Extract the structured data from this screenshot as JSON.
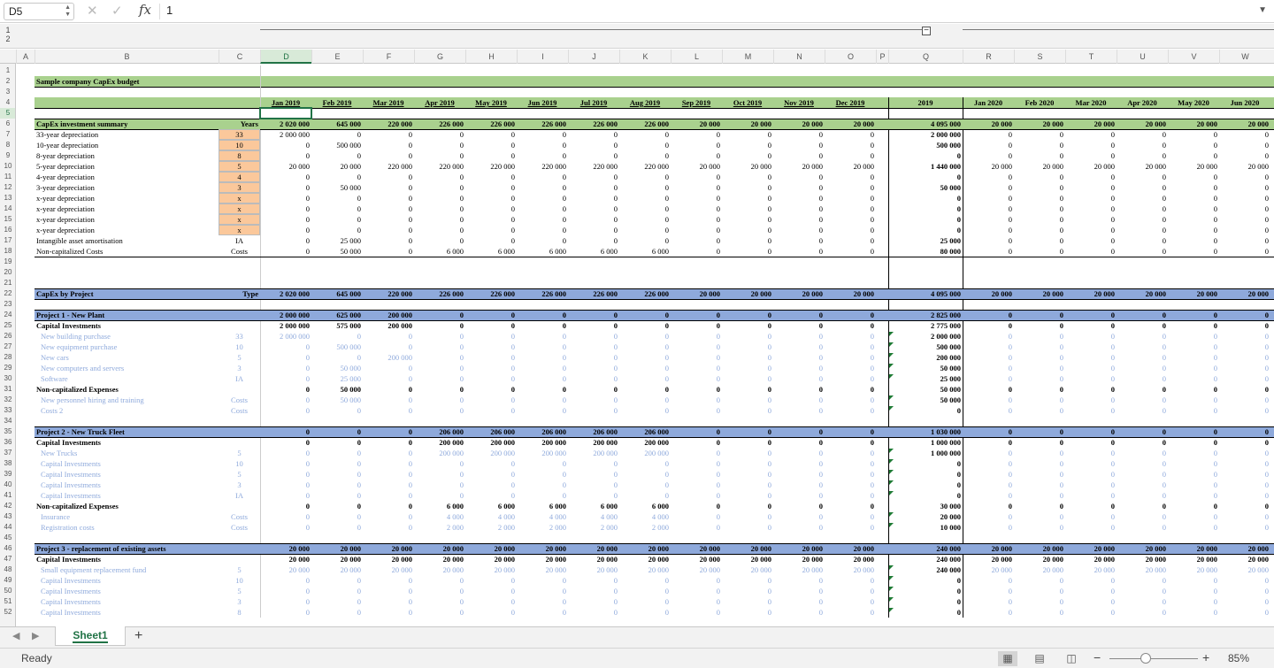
{
  "formula_bar": {
    "name_box": "D5",
    "value": "1",
    "fx": "fx",
    "cancel": "✕",
    "enter": "✓"
  },
  "outline": {
    "levels": [
      "1",
      "2"
    ],
    "collapse": "−"
  },
  "columns": [
    "A",
    "B",
    "C",
    "D",
    "E",
    "F",
    "G",
    "H",
    "I",
    "J",
    "K",
    "L",
    "M",
    "N",
    "O",
    "P",
    "Q",
    "R",
    "S",
    "T",
    "U",
    "V",
    "W"
  ],
  "selected_col": "D",
  "selected_row": 5,
  "row_count": 52,
  "title": "Sample company CapEx budget",
  "months": [
    "Jan 2019",
    "Feb 2019",
    "Mar 2019",
    "Apr 2019",
    "May 2019",
    "Jun 2019",
    "Jul 2019",
    "Aug 2019",
    "Sep 2019",
    "Oct 2019",
    "Nov 2019",
    "Dec 2019",
    "2019",
    "Jan 2020",
    "Feb 2020",
    "Mar 2020",
    "Apr 2020",
    "May 2020",
    "Jun 2020"
  ],
  "rows": [
    {
      "r": 6,
      "k": "bar",
      "label": "CapEx investment summary",
      "c": "Years",
      "v": [
        "2 020 000",
        "645 000",
        "220 000",
        "226 000",
        "226 000",
        "226 000",
        "226 000",
        "226 000",
        "20 000",
        "20 000",
        "20 000",
        "20 000",
        "4 095 000",
        "20 000",
        "20 000",
        "20 000",
        "20 000",
        "20 000",
        "20 000"
      ]
    },
    {
      "r": 7,
      "k": "yr",
      "label": "33-year depreciation",
      "c": "33",
      "v": [
        "2 000 000",
        "0",
        "0",
        "0",
        "0",
        "0",
        "0",
        "0",
        "0",
        "0",
        "0",
        "0",
        "2 000 000",
        "0",
        "0",
        "0",
        "0",
        "0",
        "0"
      ]
    },
    {
      "r": 8,
      "k": "yr",
      "label": "10-year depreciation",
      "c": "10",
      "v": [
        "0",
        "500 000",
        "0",
        "0",
        "0",
        "0",
        "0",
        "0",
        "0",
        "0",
        "0",
        "0",
        "500 000",
        "0",
        "0",
        "0",
        "0",
        "0",
        "0"
      ]
    },
    {
      "r": 9,
      "k": "yr",
      "label": "8-year depreciation",
      "c": "8",
      "v": [
        "0",
        "0",
        "0",
        "0",
        "0",
        "0",
        "0",
        "0",
        "0",
        "0",
        "0",
        "0",
        "0",
        "0",
        "0",
        "0",
        "0",
        "0",
        "0"
      ]
    },
    {
      "r": 10,
      "k": "yr",
      "label": "5-year depreciation",
      "c": "5",
      "v": [
        "20 000",
        "20 000",
        "220 000",
        "220 000",
        "220 000",
        "220 000",
        "220 000",
        "220 000",
        "20 000",
        "20 000",
        "20 000",
        "20 000",
        "1 440 000",
        "20 000",
        "20 000",
        "20 000",
        "20 000",
        "20 000",
        "20 000"
      ]
    },
    {
      "r": 11,
      "k": "yr",
      "label": "4-year depreciation",
      "c": "4",
      "v": [
        "0",
        "0",
        "0",
        "0",
        "0",
        "0",
        "0",
        "0",
        "0",
        "0",
        "0",
        "0",
        "0",
        "0",
        "0",
        "0",
        "0",
        "0",
        "0"
      ]
    },
    {
      "r": 12,
      "k": "yr",
      "label": "3-year depreciation",
      "c": "3",
      "v": [
        "0",
        "50 000",
        "0",
        "0",
        "0",
        "0",
        "0",
        "0",
        "0",
        "0",
        "0",
        "0",
        "50 000",
        "0",
        "0",
        "0",
        "0",
        "0",
        "0"
      ]
    },
    {
      "r": 13,
      "k": "yr",
      "label": "x-year depreciation",
      "c": "x",
      "v": [
        "0",
        "0",
        "0",
        "0",
        "0",
        "0",
        "0",
        "0",
        "0",
        "0",
        "0",
        "0",
        "0",
        "0",
        "0",
        "0",
        "0",
        "0",
        "0"
      ]
    },
    {
      "r": 14,
      "k": "yr",
      "label": "x-year depreciation",
      "c": "x",
      "v": [
        "0",
        "0",
        "0",
        "0",
        "0",
        "0",
        "0",
        "0",
        "0",
        "0",
        "0",
        "0",
        "0",
        "0",
        "0",
        "0",
        "0",
        "0",
        "0"
      ]
    },
    {
      "r": 15,
      "k": "yr",
      "label": "x-year depreciation",
      "c": "x",
      "v": [
        "0",
        "0",
        "0",
        "0",
        "0",
        "0",
        "0",
        "0",
        "0",
        "0",
        "0",
        "0",
        "0",
        "0",
        "0",
        "0",
        "0",
        "0",
        "0"
      ]
    },
    {
      "r": 16,
      "k": "yr",
      "label": "x-year depreciation",
      "c": "x",
      "v": [
        "0",
        "0",
        "0",
        "0",
        "0",
        "0",
        "0",
        "0",
        "0",
        "0",
        "0",
        "0",
        "0",
        "0",
        "0",
        "0",
        "0",
        "0",
        "0"
      ]
    },
    {
      "r": 17,
      "k": "n",
      "label": "Intangible asset amortisation",
      "c": "IA",
      "v": [
        "0",
        "25 000",
        "0",
        "0",
        "0",
        "0",
        "0",
        "0",
        "0",
        "0",
        "0",
        "0",
        "25 000",
        "0",
        "0",
        "0",
        "0",
        "0",
        "0"
      ]
    },
    {
      "r": 18,
      "k": "n",
      "label": "Non-capitalized Costs",
      "c": "Costs",
      "v": [
        "0",
        "50 000",
        "0",
        "6 000",
        "6 000",
        "6 000",
        "6 000",
        "6 000",
        "0",
        "0",
        "0",
        "0",
        "80 000",
        "0",
        "0",
        "0",
        "0",
        "0",
        "0"
      ]
    },
    {
      "r": 22,
      "k": "blue",
      "label": "CapEx by Project",
      "c": "Type",
      "v": [
        "2 020 000",
        "645 000",
        "220 000",
        "226 000",
        "226 000",
        "226 000",
        "226 000",
        "226 000",
        "20 000",
        "20 000",
        "20 000",
        "20 000",
        "4 095 000",
        "20 000",
        "20 000",
        "20 000",
        "20 000",
        "20 000",
        "20 000"
      ]
    },
    {
      "r": 24,
      "k": "blue",
      "label": "Project 1 - New Plant",
      "c": "",
      "v": [
        "2 000 000",
        "625 000",
        "200 000",
        "0",
        "0",
        "0",
        "0",
        "0",
        "0",
        "0",
        "0",
        "0",
        "2 825 000",
        "0",
        "0",
        "0",
        "0",
        "0",
        "0"
      ]
    },
    {
      "r": 25,
      "k": "bold",
      "label": "Capital Investments",
      "c": "",
      "v": [
        "2 000 000",
        "575 000",
        "200 000",
        "0",
        "0",
        "0",
        "0",
        "0",
        "0",
        "0",
        "0",
        "0",
        "2 775 000",
        "0",
        "0",
        "0",
        "0",
        "0",
        "0"
      ]
    },
    {
      "r": 26,
      "k": "light",
      "label": "New building purchase",
      "c": "33",
      "v": [
        "2 000 000",
        "0",
        "0",
        "0",
        "0",
        "0",
        "0",
        "0",
        "0",
        "0",
        "0",
        "0",
        "2 000 000",
        "0",
        "0",
        "0",
        "0",
        "0",
        "0"
      ]
    },
    {
      "r": 27,
      "k": "light",
      "label": "New equipment purchase",
      "c": "10",
      "v": [
        "0",
        "500 000",
        "0",
        "0",
        "0",
        "0",
        "0",
        "0",
        "0",
        "0",
        "0",
        "0",
        "500 000",
        "0",
        "0",
        "0",
        "0",
        "0",
        "0"
      ]
    },
    {
      "r": 28,
      "k": "light",
      "label": "New cars",
      "c": "5",
      "v": [
        "0",
        "0",
        "200 000",
        "0",
        "0",
        "0",
        "0",
        "0",
        "0",
        "0",
        "0",
        "0",
        "200 000",
        "0",
        "0",
        "0",
        "0",
        "0",
        "0"
      ]
    },
    {
      "r": 29,
      "k": "light",
      "label": "New computers and servers",
      "c": "3",
      "v": [
        "0",
        "50 000",
        "0",
        "0",
        "0",
        "0",
        "0",
        "0",
        "0",
        "0",
        "0",
        "0",
        "50 000",
        "0",
        "0",
        "0",
        "0",
        "0",
        "0"
      ]
    },
    {
      "r": 30,
      "k": "light",
      "label": "Software",
      "c": "IA",
      "v": [
        "0",
        "25 000",
        "0",
        "0",
        "0",
        "0",
        "0",
        "0",
        "0",
        "0",
        "0",
        "0",
        "25 000",
        "0",
        "0",
        "0",
        "0",
        "0",
        "0"
      ]
    },
    {
      "r": 31,
      "k": "bold",
      "label": "Non-capitalized Expenses",
      "c": "",
      "v": [
        "0",
        "50 000",
        "0",
        "0",
        "0",
        "0",
        "0",
        "0",
        "0",
        "0",
        "0",
        "0",
        "50 000",
        "0",
        "0",
        "0",
        "0",
        "0",
        "0"
      ]
    },
    {
      "r": 32,
      "k": "light",
      "label": "New personnel hiring and training",
      "c": "Costs",
      "v": [
        "0",
        "50 000",
        "0",
        "0",
        "0",
        "0",
        "0",
        "0",
        "0",
        "0",
        "0",
        "0",
        "50 000",
        "0",
        "0",
        "0",
        "0",
        "0",
        "0"
      ]
    },
    {
      "r": 33,
      "k": "light",
      "label": "Costs 2",
      "c": "Costs",
      "v": [
        "0",
        "0",
        "0",
        "0",
        "0",
        "0",
        "0",
        "0",
        "0",
        "0",
        "0",
        "0",
        "0",
        "0",
        "0",
        "0",
        "0",
        "0",
        "0"
      ]
    },
    {
      "r": 35,
      "k": "blue",
      "label": "Project 2 - New Truck Fleet",
      "c": "",
      "v": [
        "0",
        "0",
        "0",
        "206 000",
        "206 000",
        "206 000",
        "206 000",
        "206 000",
        "0",
        "0",
        "0",
        "0",
        "1 030 000",
        "0",
        "0",
        "0",
        "0",
        "0",
        "0"
      ]
    },
    {
      "r": 36,
      "k": "bold",
      "label": "Capital Investments",
      "c": "",
      "v": [
        "0",
        "0",
        "0",
        "200 000",
        "200 000",
        "200 000",
        "200 000",
        "200 000",
        "0",
        "0",
        "0",
        "0",
        "1 000 000",
        "0",
        "0",
        "0",
        "0",
        "0",
        "0"
      ]
    },
    {
      "r": 37,
      "k": "light",
      "label": "New Trucks",
      "c": "5",
      "v": [
        "0",
        "0",
        "0",
        "200 000",
        "200 000",
        "200 000",
        "200 000",
        "200 000",
        "0",
        "0",
        "0",
        "0",
        "1 000 000",
        "0",
        "0",
        "0",
        "0",
        "0",
        "0"
      ]
    },
    {
      "r": 38,
      "k": "light",
      "label": "Capital Investments",
      "c": "10",
      "v": [
        "0",
        "0",
        "0",
        "0",
        "0",
        "0",
        "0",
        "0",
        "0",
        "0",
        "0",
        "0",
        "0",
        "0",
        "0",
        "0",
        "0",
        "0",
        "0"
      ]
    },
    {
      "r": 39,
      "k": "light",
      "label": "Capital Investments",
      "c": "5",
      "v": [
        "0",
        "0",
        "0",
        "0",
        "0",
        "0",
        "0",
        "0",
        "0",
        "0",
        "0",
        "0",
        "0",
        "0",
        "0",
        "0",
        "0",
        "0",
        "0"
      ]
    },
    {
      "r": 40,
      "k": "light",
      "label": "Capital Investments",
      "c": "3",
      "v": [
        "0",
        "0",
        "0",
        "0",
        "0",
        "0",
        "0",
        "0",
        "0",
        "0",
        "0",
        "0",
        "0",
        "0",
        "0",
        "0",
        "0",
        "0",
        "0"
      ]
    },
    {
      "r": 41,
      "k": "light",
      "label": "Capital Investments",
      "c": "IA",
      "v": [
        "0",
        "0",
        "0",
        "0",
        "0",
        "0",
        "0",
        "0",
        "0",
        "0",
        "0",
        "0",
        "0",
        "0",
        "0",
        "0",
        "0",
        "0",
        "0"
      ]
    },
    {
      "r": 42,
      "k": "bold",
      "label": "Non-capitalized Expenses",
      "c": "",
      "v": [
        "0",
        "0",
        "0",
        "6 000",
        "6 000",
        "6 000",
        "6 000",
        "6 000",
        "0",
        "0",
        "0",
        "0",
        "30 000",
        "0",
        "0",
        "0",
        "0",
        "0",
        "0"
      ]
    },
    {
      "r": 43,
      "k": "light",
      "label": "Insurance",
      "c": "Costs",
      "v": [
        "0",
        "0",
        "0",
        "4 000",
        "4 000",
        "4 000",
        "4 000",
        "4 000",
        "0",
        "0",
        "0",
        "0",
        "20 000",
        "0",
        "0",
        "0",
        "0",
        "0",
        "0"
      ]
    },
    {
      "r": 44,
      "k": "light",
      "label": "Registration costs",
      "c": "Costs",
      "v": [
        "0",
        "0",
        "0",
        "2 000",
        "2 000",
        "2 000",
        "2 000",
        "2 000",
        "0",
        "0",
        "0",
        "0",
        "10 000",
        "0",
        "0",
        "0",
        "0",
        "0",
        "0"
      ]
    },
    {
      "r": 46,
      "k": "blue",
      "label": "Project 3 - replacement of existing assets",
      "c": "",
      "v": [
        "20 000",
        "20 000",
        "20 000",
        "20 000",
        "20 000",
        "20 000",
        "20 000",
        "20 000",
        "20 000",
        "20 000",
        "20 000",
        "20 000",
        "240 000",
        "20 000",
        "20 000",
        "20 000",
        "20 000",
        "20 000",
        "20 000"
      ]
    },
    {
      "r": 47,
      "k": "bold",
      "label": "Capital Investments",
      "c": "",
      "v": [
        "20 000",
        "20 000",
        "20 000",
        "20 000",
        "20 000",
        "20 000",
        "20 000",
        "20 000",
        "20 000",
        "20 000",
        "20 000",
        "20 000",
        "240 000",
        "20 000",
        "20 000",
        "20 000",
        "20 000",
        "20 000",
        "20 000"
      ]
    },
    {
      "r": 48,
      "k": "light",
      "label": "Small equipment replacement fund",
      "c": "5",
      "v": [
        "20 000",
        "20 000",
        "20 000",
        "20 000",
        "20 000",
        "20 000",
        "20 000",
        "20 000",
        "20 000",
        "20 000",
        "20 000",
        "20 000",
        "240 000",
        "20 000",
        "20 000",
        "20 000",
        "20 000",
        "20 000",
        "20 000"
      ]
    },
    {
      "r": 49,
      "k": "light",
      "label": "Capital Investments",
      "c": "10",
      "v": [
        "0",
        "0",
        "0",
        "0",
        "0",
        "0",
        "0",
        "0",
        "0",
        "0",
        "0",
        "0",
        "0",
        "0",
        "0",
        "0",
        "0",
        "0",
        "0"
      ]
    },
    {
      "r": 50,
      "k": "light",
      "label": "Capital Investments",
      "c": "5",
      "v": [
        "0",
        "0",
        "0",
        "0",
        "0",
        "0",
        "0",
        "0",
        "0",
        "0",
        "0",
        "0",
        "0",
        "0",
        "0",
        "0",
        "0",
        "0",
        "0"
      ]
    },
    {
      "r": 51,
      "k": "light",
      "label": "Capital Investments",
      "c": "3",
      "v": [
        "0",
        "0",
        "0",
        "0",
        "0",
        "0",
        "0",
        "0",
        "0",
        "0",
        "0",
        "0",
        "0",
        "0",
        "0",
        "0",
        "0",
        "0",
        "0"
      ]
    },
    {
      "r": 52,
      "k": "light",
      "label": "Capital Investments",
      "c": "8",
      "v": [
        "0",
        "0",
        "0",
        "0",
        "0",
        "0",
        "0",
        "0",
        "0",
        "0",
        "0",
        "0",
        "0",
        "0",
        "0",
        "0",
        "0",
        "0",
        "0"
      ]
    }
  ],
  "sheet_tabs": [
    "Sheet1"
  ],
  "add_sheet": "+",
  "nav": {
    "prev": "◀",
    "next": "▶"
  },
  "status": {
    "ready": "Ready",
    "zoom": "85%",
    "zoom_minus": "−",
    "zoom_plus": "+"
  },
  "colors": {
    "green_band": "#a9d18e",
    "blue_band": "#8ea9db",
    "cat_input": "#fbc89b",
    "light_text": "#8faadc",
    "accent": "#217346"
  }
}
